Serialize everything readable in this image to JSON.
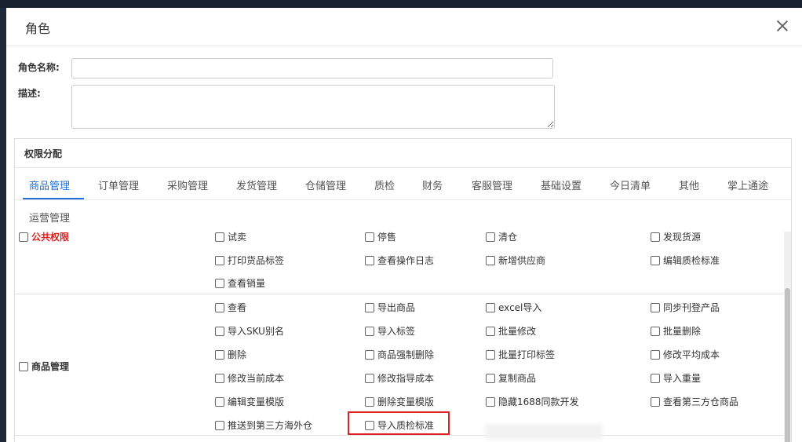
{
  "dialog": {
    "title": "角色"
  },
  "form": {
    "name_label": "角色名称:",
    "desc_label": "描述:"
  },
  "permissions": {
    "title": "权限分配",
    "tabs": [
      "商品管理",
      "订单管理",
      "采购管理",
      "发货管理",
      "仓储管理",
      "质检",
      "财务",
      "客服管理",
      "基础设置",
      "今日清单",
      "其他",
      "掌上通途"
    ],
    "section": "运营管理",
    "groups": [
      {
        "label": "公共权限",
        "items": [
          "试卖",
          "停售",
          "清仓",
          "发现货源",
          "打印货品标签",
          "查看操作日志",
          "新增供应商",
          "编辑质检标准",
          "查看销量"
        ]
      },
      {
        "label": "商品管理",
        "items": [
          "查看",
          "导出商品",
          "excel导入",
          "同步刊登产品",
          "导入SKU别名",
          "导入标签",
          "批量修改",
          "批量删除",
          "删除",
          "商品强制删除",
          "批量打印标签",
          "修改平均成本",
          "修改当前成本",
          "修改指导成本",
          "复制商品",
          "导入重量",
          "编辑变量模版",
          "删除变量模版",
          "隐藏1688同款开发",
          "查看第三方仓商品",
          "推送到第三方海外仓",
          "导入质检标准"
        ]
      }
    ]
  }
}
